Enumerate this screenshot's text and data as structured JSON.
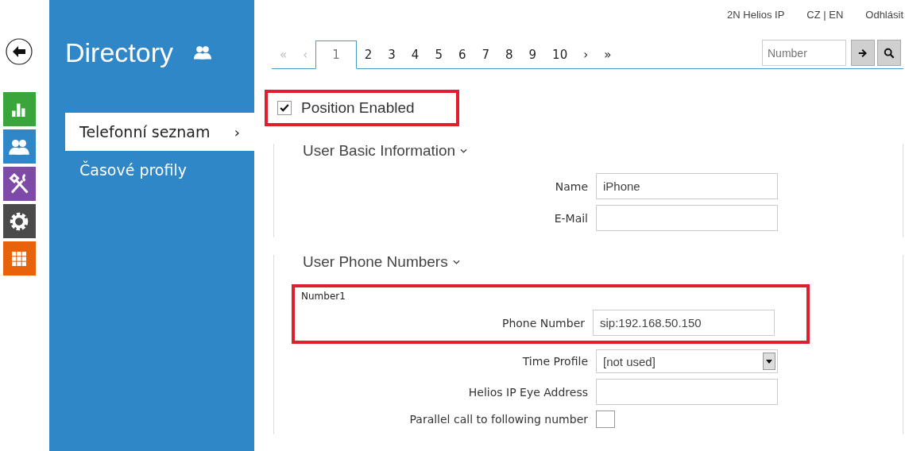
{
  "rail": [
    {
      "kind": "back"
    },
    {
      "kind": "stats",
      "color": "#3aa53a"
    },
    {
      "kind": "users",
      "color": "#2f87c8"
    },
    {
      "kind": "tools",
      "color": "#7e4aa7"
    },
    {
      "kind": "gear",
      "color": "#4a4a4a"
    },
    {
      "kind": "grid",
      "color": "#e8620c"
    }
  ],
  "top_links": [
    "2N Helios IP",
    "CZ | EN",
    "Odhlásit"
  ],
  "panel": {
    "title": "Directory",
    "items": [
      {
        "label": "Telefonní seznam",
        "arrow": "›",
        "selected": true
      },
      {
        "label": "Časové profily",
        "selected": false
      }
    ]
  },
  "pagination": {
    "first": "«",
    "prev": "‹",
    "back_disabled": true,
    "pages": [
      {
        "label": "1",
        "selected": true
      },
      {
        "label": "2",
        "selected": false
      },
      {
        "label": "3",
        "selected": false
      },
      {
        "label": "4",
        "selected": false
      },
      {
        "label": "5",
        "selected": false
      },
      {
        "label": "6",
        "selected": false
      },
      {
        "label": "7",
        "selected": false
      },
      {
        "label": "8",
        "selected": false
      },
      {
        "label": "9",
        "selected": false
      },
      {
        "label": "10",
        "selected": false
      }
    ],
    "next": "›",
    "last": "»",
    "search": {
      "placeholder": "Number"
    }
  },
  "position_enabled": {
    "label": "Position Enabled",
    "checked": true,
    "highlighted": true
  },
  "sections": [
    {
      "title": "User Basic Information",
      "rows": [
        {
          "kind": "text",
          "label": "Name",
          "value": "iPhone"
        },
        {
          "kind": "text",
          "label": "E-Mail"
        }
      ]
    },
    {
      "title": "User Phone Numbers",
      "group": {
        "title": "Number1",
        "highlighted": true,
        "rows": [
          {
            "kind": "text",
            "label": "Phone Number",
            "value": "sip:192.168.50.150"
          }
        ]
      },
      "rows": [
        {
          "kind": "select",
          "label": "Time Profile",
          "value": "[not used]"
        },
        {
          "kind": "text",
          "label": "Helios IP Eye Address"
        },
        {
          "kind": "checkbox",
          "label": "Parallel call to following number",
          "checked": false
        }
      ]
    }
  ]
}
